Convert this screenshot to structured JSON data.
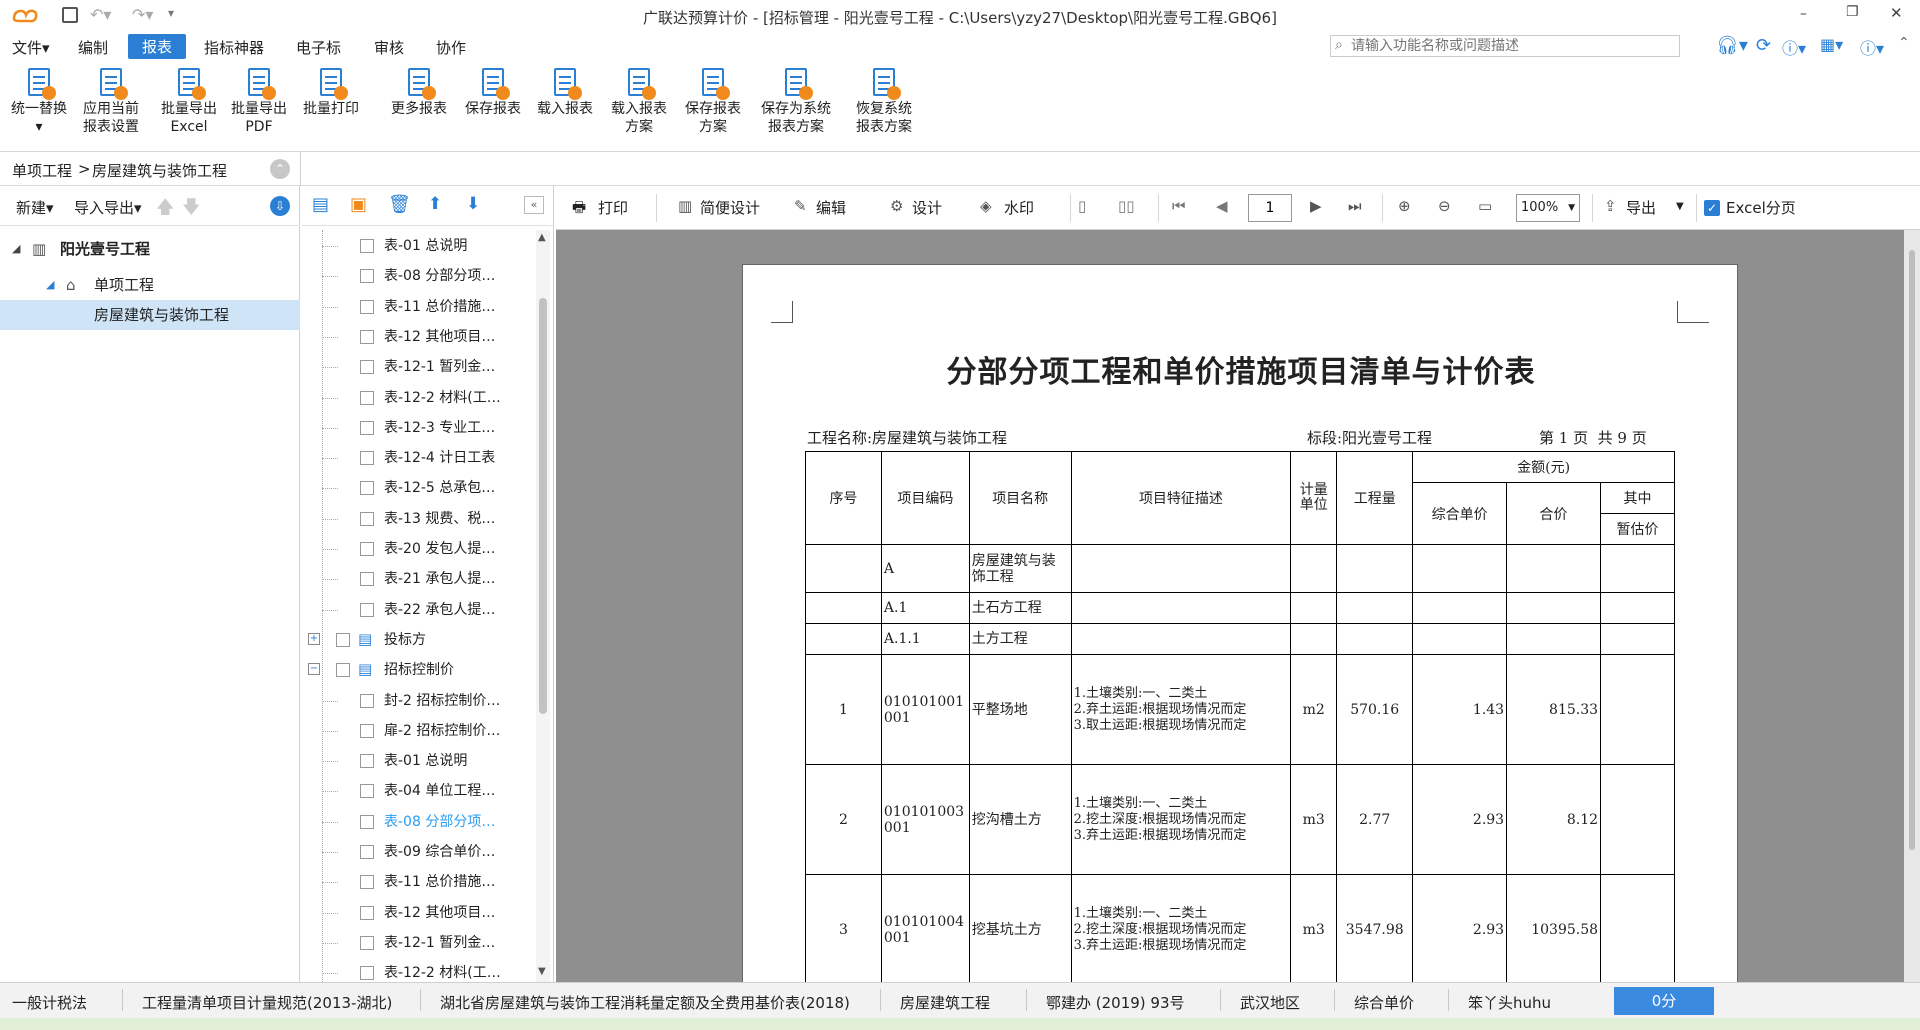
{
  "app": {
    "title": "广联达预算计价 - [招标管理 - 阳光壹号工程 - C:\\Users\\yzy27\\Desktop\\阳光壹号工程.GBQ6]",
    "search_placeholder": "请输入功能名称或问题描述",
    "accent": "#2a7fd4"
  },
  "menu": {
    "items": [
      "文件▾",
      "编制",
      "报表",
      "指标神器",
      "电子标",
      "审核",
      "协作"
    ],
    "active": "报表"
  },
  "ribbon": {
    "buttons": [
      {
        "l1": "统一替换",
        "l2": "▾"
      },
      {
        "l1": "应用当前",
        "l2": "报表设置"
      },
      {
        "l1": "批量导出",
        "l2": "Excel"
      },
      {
        "l1": "批量导出",
        "l2": "PDF"
      },
      {
        "l1": "批量打印",
        "l2": ""
      },
      {
        "l1": "更多报表",
        "l2": ""
      },
      {
        "l1": "保存报表",
        "l2": ""
      },
      {
        "l1": "载入报表",
        "l2": ""
      },
      {
        "l1": "载入报表",
        "l2": "方案"
      },
      {
        "l1": "保存报表",
        "l2": "方案"
      },
      {
        "l1": "保存为系统",
        "l2": "报表方案"
      },
      {
        "l1": "恢复系统",
        "l2": "报表方案"
      }
    ]
  },
  "breadcrumb": {
    "part1": "单项工程",
    "sep": ">",
    "part2": "房屋建筑与装饰工程"
  },
  "left": {
    "new_label": "新建▾",
    "import_label": "导入导出▾",
    "tree": [
      {
        "label": "阳光壹号工程",
        "level": 0
      },
      {
        "label": "单项工程",
        "level": 1
      },
      {
        "label": "房屋建筑与装饰工程",
        "level": 2
      }
    ]
  },
  "reports": {
    "items": [
      {
        "label": "表-01 总说明",
        "type": "leaf"
      },
      {
        "label": "表-08 分部分项…",
        "type": "leaf"
      },
      {
        "label": "表-11 总价措施…",
        "type": "leaf"
      },
      {
        "label": "表-12 其他项目…",
        "type": "leaf"
      },
      {
        "label": "表-12-1 暂列金…",
        "type": "leaf"
      },
      {
        "label": "表-12-2 材料(工…",
        "type": "leaf"
      },
      {
        "label": "表-12-3 专业工…",
        "type": "leaf"
      },
      {
        "label": "表-12-4 计日工表",
        "type": "leaf"
      },
      {
        "label": "表-12-5 总承包…",
        "type": "leaf"
      },
      {
        "label": "表-13 规费、税…",
        "type": "leaf"
      },
      {
        "label": "表-20 发包人提…",
        "type": "leaf"
      },
      {
        "label": "表-21 承包人提…",
        "type": "leaf"
      },
      {
        "label": "表-22 承包人提…",
        "type": "leaf"
      },
      {
        "label": "投标方",
        "type": "folder",
        "expand": "+"
      },
      {
        "label": "招标控制价",
        "type": "folder",
        "expand": "−"
      },
      {
        "label": "封-2 招标控制价…",
        "type": "leaf"
      },
      {
        "label": "扉-2 招标控制价…",
        "type": "leaf"
      },
      {
        "label": "表-01 总说明",
        "type": "leaf"
      },
      {
        "label": "表-04 单位工程…",
        "type": "leaf"
      },
      {
        "label": "表-08 分部分项…",
        "type": "leaf",
        "active": true
      },
      {
        "label": "表-09 综合单价…",
        "type": "leaf"
      },
      {
        "label": "表-11 总价措施…",
        "type": "leaf"
      },
      {
        "label": "表-12 其他项目…",
        "type": "leaf"
      },
      {
        "label": "表-12-1 暂列金…",
        "type": "leaf"
      },
      {
        "label": "表-12-2 材料(工…",
        "type": "leaf"
      }
    ]
  },
  "viewer": {
    "print": "打印",
    "simple_design": "简便设计",
    "edit": "编辑",
    "design": "设计",
    "watermark": "水印",
    "page_value": "1",
    "zoom": "100%",
    "export": "导出",
    "excel_paging": "Excel分页"
  },
  "report": {
    "title": "分部分项工程和单价措施项目清单与计价表",
    "project_label": "工程名称:房屋建筑与装饰工程",
    "section_label": "标段:阳光壹号工程",
    "page_label": "第 1 页  共 9 页",
    "headers": {
      "no": "序号",
      "code": "项目编码",
      "name": "项目名称",
      "desc": "项目特征描述",
      "unit": "计量单位",
      "qty": "工程量",
      "amount": "金额(元)",
      "unit_price": "综合单价",
      "total": "合价",
      "among": "其中",
      "provisional": "暂估价"
    },
    "rows": [
      {
        "no": "",
        "code": "A",
        "name": "房屋建筑与装饰工程",
        "desc": "",
        "unit": "",
        "qty": "",
        "price": "",
        "total": "",
        "prov": ""
      },
      {
        "no": "",
        "code": "A.1",
        "name": "土石方工程",
        "desc": "",
        "unit": "",
        "qty": "",
        "price": "",
        "total": "",
        "prov": ""
      },
      {
        "no": "",
        "code": "A.1.1",
        "name": "土方工程",
        "desc": "",
        "unit": "",
        "qty": "",
        "price": "",
        "total": "",
        "prov": ""
      },
      {
        "no": "1",
        "code": "010101001001",
        "name": "平整场地",
        "desc": "1.土壤类别:一、二类土\n2.弃土运距:根据现场情况而定\n3.取土运距:根据现场情况而定",
        "unit": "m2",
        "qty": "570.16",
        "price": "1.43",
        "total": "815.33",
        "prov": ""
      },
      {
        "no": "2",
        "code": "010101003001",
        "name": "挖沟槽土方",
        "desc": "1.土壤类别:一、二类土\n2.挖土深度:根据现场情况而定\n3.弃土运距:根据现场情况而定",
        "unit": "m3",
        "qty": "2.77",
        "price": "2.93",
        "total": "8.12",
        "prov": ""
      },
      {
        "no": "3",
        "code": "010101004001",
        "name": "挖基坑土方",
        "desc": "1.土壤类别:一、二类土\n2.挖土深度:根据现场情况而定\n3.弃土运距:根据现场情况而定",
        "unit": "m3",
        "qty": "3547.98",
        "price": "2.93",
        "total": "10395.58",
        "prov": ""
      }
    ]
  },
  "status": {
    "items": [
      "一般计税法",
      "工程量清单项目计量规范(2013-湖北)",
      "湖北省房屋建筑与装饰工程消耗量定额及全费用基价表(2018)",
      "房屋建筑工程",
      "鄂建办 (2019) 93号",
      "武汉地区",
      "综合单价",
      "笨丫头huhu"
    ],
    "score": "0分"
  }
}
